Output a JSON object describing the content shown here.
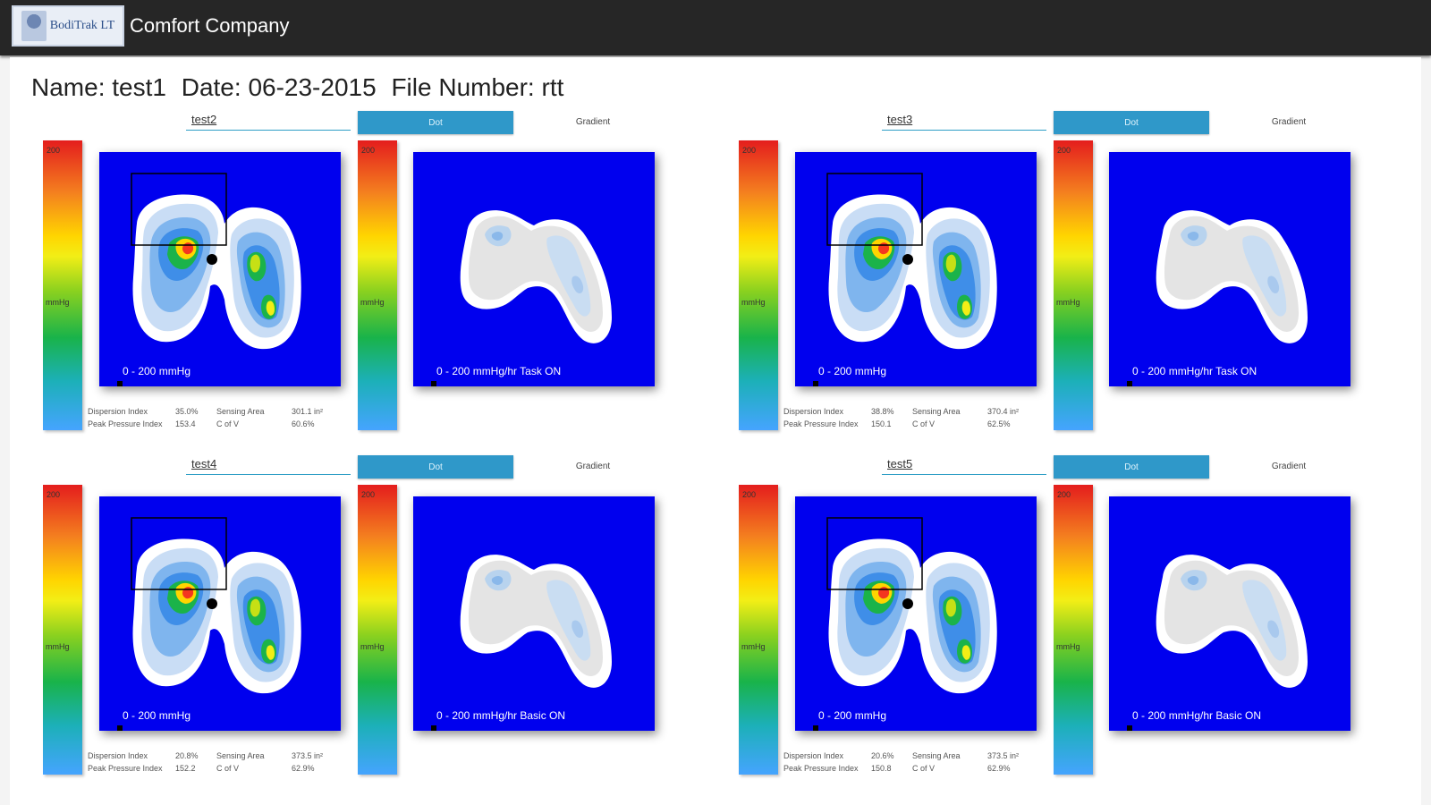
{
  "app": {
    "title": "Comfort Company",
    "logo_text": "BodiTrak LT"
  },
  "header": {
    "name": "Name: test1",
    "date": "Date: 06-23-2015",
    "file": "File Number: rtt"
  },
  "panels": [
    {
      "name": "test2",
      "dot_label": "Dot",
      "gradient_label": "Gradient",
      "scale_max": "200",
      "scale_unit": "mmHg",
      "left_map_label": "0 - 200 mmHg",
      "right_map_label": "0 - 200 mmHg/hr  Task ON",
      "stats": {
        "dispersion_label": "Dispersion Index",
        "dispersion_value": "35.0%",
        "sensing_label": "Sensing Area",
        "sensing_value": "301.1 in²",
        "peak_label": "Peak Pressure Index",
        "peak_value": "153.4",
        "cofv_label": "C of V",
        "cofv_value": "60.6%"
      }
    },
    {
      "name": "test3",
      "dot_label": "Dot",
      "gradient_label": "Gradient",
      "scale_max": "200",
      "scale_unit": "mmHg",
      "left_map_label": "0 - 200 mmHg",
      "right_map_label": "0 - 200 mmHg/hr  Task ON",
      "stats": {
        "dispersion_label": "Dispersion Index",
        "dispersion_value": "38.8%",
        "sensing_label": "Sensing Area",
        "sensing_value": "370.4 in²",
        "peak_label": "Peak Pressure Index",
        "peak_value": "150.1",
        "cofv_label": "C of V",
        "cofv_value": "62.5%"
      }
    },
    {
      "name": "test4",
      "dot_label": "Dot",
      "gradient_label": "Gradient",
      "scale_max": "200",
      "scale_unit": "mmHg",
      "left_map_label": "0 - 200 mmHg",
      "right_map_label": "0 - 200 mmHg/hr  Basic ON",
      "stats": {
        "dispersion_label": "Dispersion Index",
        "dispersion_value": "20.8%",
        "sensing_label": "Sensing Area",
        "sensing_value": "373.5 in²",
        "peak_label": "Peak Pressure Index",
        "peak_value": "152.2",
        "cofv_label": "C of V",
        "cofv_value": "62.9%"
      }
    },
    {
      "name": "test5",
      "dot_label": "Dot",
      "gradient_label": "Gradient",
      "scale_max": "200",
      "scale_unit": "mmHg",
      "left_map_label": "0 - 200 mmHg",
      "right_map_label": "0 - 200 mmHg/hr  Basic ON",
      "stats": {
        "dispersion_label": "Dispersion Index",
        "dispersion_value": "20.6%",
        "sensing_label": "Sensing Area",
        "sensing_value": "373.5 in²",
        "peak_label": "Peak Pressure Index",
        "peak_value": "150.8",
        "cofv_label": "C of V",
        "cofv_value": "62.9%"
      }
    }
  ]
}
